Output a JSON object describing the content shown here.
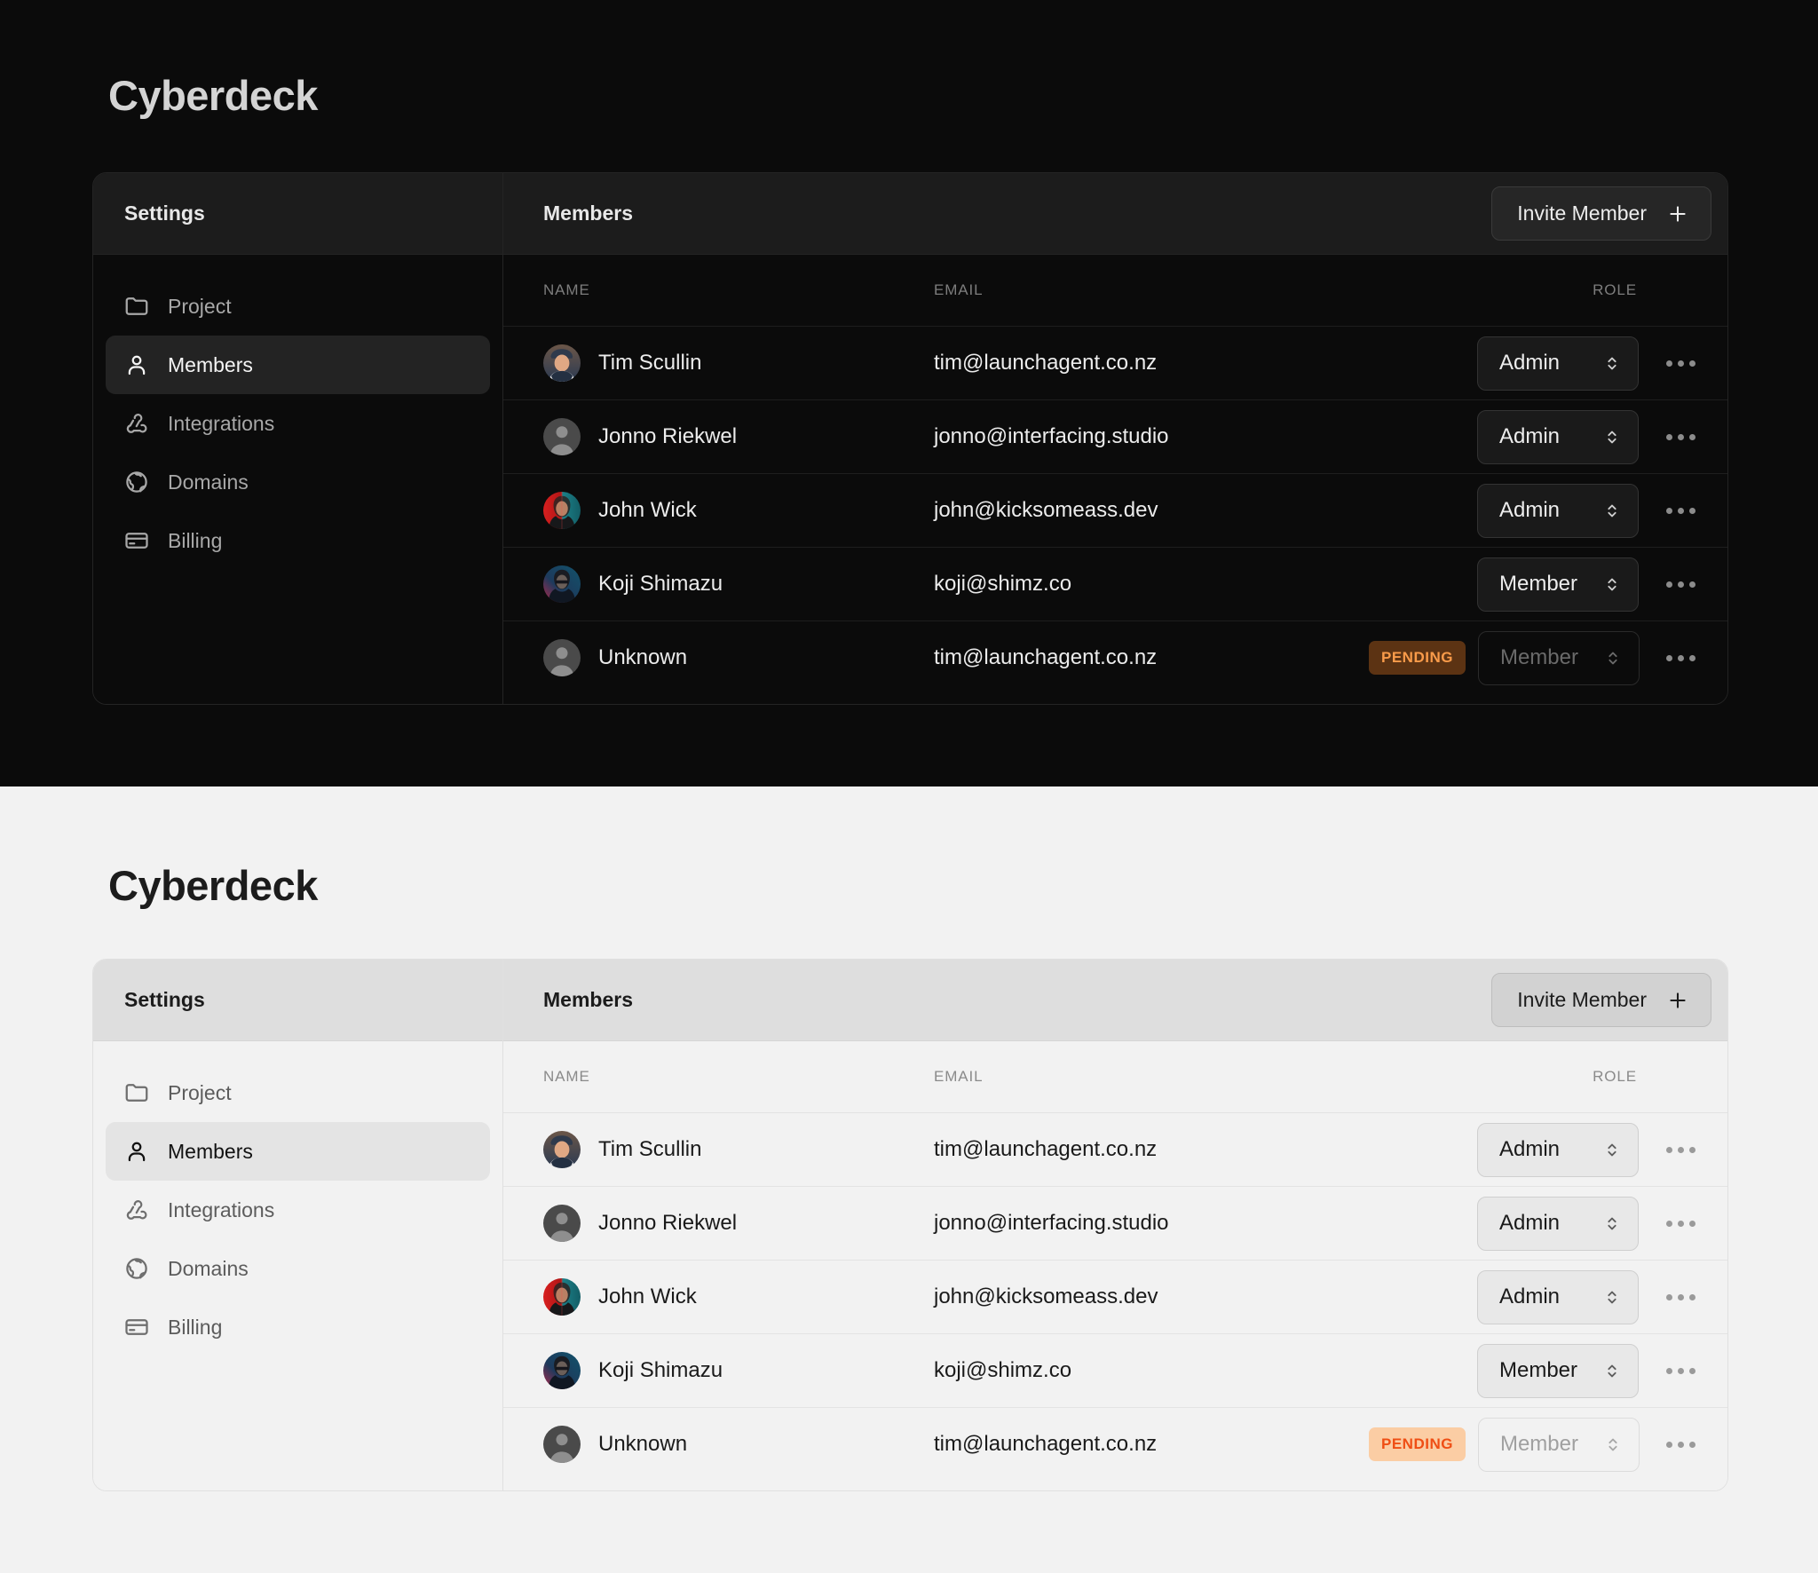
{
  "app": {
    "title": "Cyberdeck"
  },
  "sidebar": {
    "header": "Settings",
    "items": [
      {
        "label": "Project",
        "icon": "folder-icon"
      },
      {
        "label": "Members",
        "icon": "user-icon"
      },
      {
        "label": "Integrations",
        "icon": "webhook-icon"
      },
      {
        "label": "Domains",
        "icon": "globe-icon"
      },
      {
        "label": "Billing",
        "icon": "credit-card-icon"
      }
    ],
    "active": "Members"
  },
  "content": {
    "title": "Members",
    "invite_label": "Invite Member",
    "columns": {
      "name": "NAME",
      "email": "EMAIL",
      "role": "ROLE"
    }
  },
  "members": [
    {
      "name": "Tim Scullin",
      "email": "tim@launchagent.co.nz",
      "role": "Admin",
      "badge": "",
      "avatar": "photo-tim",
      "disabled": false
    },
    {
      "name": "Jonno Riekwel",
      "email": "jonno@interfacing.studio",
      "role": "Admin",
      "badge": "",
      "avatar": "placeholder",
      "disabled": false
    },
    {
      "name": "John Wick",
      "email": "john@kicksomeass.dev",
      "role": "Admin",
      "badge": "",
      "avatar": "photo-john",
      "disabled": false
    },
    {
      "name": "Koji Shimazu",
      "email": "koji@shimz.co",
      "role": "Member",
      "badge": "",
      "avatar": "photo-koji",
      "disabled": false
    },
    {
      "name": "Unknown",
      "email": "tim@launchagent.co.nz",
      "role": "Member",
      "badge": "PENDING",
      "avatar": "placeholder",
      "disabled": true
    }
  ],
  "role_options": [
    "Admin",
    "Member"
  ],
  "colors": {
    "dark_bg": "#0b0b0b",
    "light_bg": "#f2f2f2",
    "badge_text_dark": "#f99b4a",
    "badge_bg_dark": "#5c3313",
    "badge_text_light": "#ef4e14",
    "badge_bg_light": "#fbcda4"
  }
}
